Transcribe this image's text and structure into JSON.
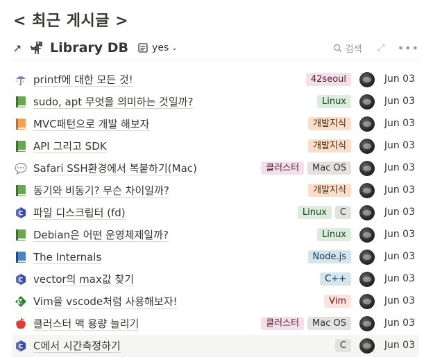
{
  "page": {
    "title": "< 최근 게시글 >"
  },
  "db_header": {
    "arrow": "↗",
    "title": "Library DB",
    "view_label": "yes",
    "search_label": "검색",
    "expand_glyph": "⤢",
    "more_glyph": "•••"
  },
  "tag_colors": {
    "pink": {
      "bg": "#f5e0e9",
      "fg": "#4c2337"
    },
    "green": {
      "bg": "#dbeddb",
      "fg": "#1c3829"
    },
    "orange": {
      "bg": "#fadec9",
      "fg": "#49290e"
    },
    "gray": {
      "bg": "#e3e2e0",
      "fg": "#32302c"
    },
    "blue": {
      "bg": "#d3e5ef",
      "fg": "#183347"
    },
    "red": {
      "bg": "#ffe2dd",
      "fg": "#5d1715"
    }
  },
  "rows": [
    {
      "icon": "umbrella-icon",
      "title": "printf에 대한 모든 것!",
      "tags": [
        {
          "label": "42seoul",
          "color": "pink"
        }
      ],
      "date": "Jun 03"
    },
    {
      "icon": "green-book-icon",
      "title": "sudo, apt 무엇을 의미하는 것일까?",
      "tags": [
        {
          "label": "Linux",
          "color": "green"
        }
      ],
      "date": "Jun 03"
    },
    {
      "icon": "orange-book-icon",
      "title": "MVC패턴으로 개발 해보자",
      "tags": [
        {
          "label": "개발지식",
          "color": "orange"
        }
      ],
      "date": "Jun 03"
    },
    {
      "icon": "green-book-icon",
      "title": "API 그리고 SDK",
      "tags": [
        {
          "label": "개발지식",
          "color": "orange"
        }
      ],
      "date": "Jun 03"
    },
    {
      "icon": "speech-bubble-icon",
      "title": "Safari SSH환경에서 복붙하기(Mac)",
      "tags": [
        {
          "label": "클러스터",
          "color": "pink"
        },
        {
          "label": "Mac OS",
          "color": "gray"
        }
      ],
      "date": "Jun 03"
    },
    {
      "icon": "green-book-icon",
      "title": "동기와 비동기? 무슨 차이일까?",
      "tags": [
        {
          "label": "개발지식",
          "color": "orange"
        }
      ],
      "date": "Jun 03"
    },
    {
      "icon": "c-language-icon",
      "title": "파일 디스크립터 (fd)",
      "tags": [
        {
          "label": "Linux",
          "color": "green"
        },
        {
          "label": "C",
          "color": "gray"
        }
      ],
      "date": "Jun 03"
    },
    {
      "icon": "green-book-icon",
      "title": "Debian은 어떤 운영체제일까?",
      "tags": [
        {
          "label": "Linux",
          "color": "green"
        }
      ],
      "date": "Jun 03"
    },
    {
      "icon": "blue-book-icon",
      "title": "The Internals",
      "tags": [
        {
          "label": "Node.js",
          "color": "blue"
        }
      ],
      "date": "Jun 03"
    },
    {
      "icon": "c-language-icon",
      "title": "vector의 max값 찾기",
      "tags": [
        {
          "label": "C++",
          "color": "blue"
        }
      ],
      "date": "Jun 03"
    },
    {
      "icon": "vim-logo-icon",
      "title": "Vim을 vscode처럼 사용해보자!",
      "tags": [
        {
          "label": "Vim",
          "color": "red"
        }
      ],
      "date": "Jun 03"
    },
    {
      "icon": "apple-icon",
      "title": "클러스터 맥 용량 늘리기",
      "tags": [
        {
          "label": "클러스터",
          "color": "pink"
        },
        {
          "label": "Mac OS",
          "color": "gray"
        }
      ],
      "date": "Jun 03"
    },
    {
      "icon": "c-language-icon",
      "title": "C에서 시간측정하기",
      "tags": [
        {
          "label": "C",
          "color": "gray"
        }
      ],
      "date": "Jun 03"
    }
  ]
}
